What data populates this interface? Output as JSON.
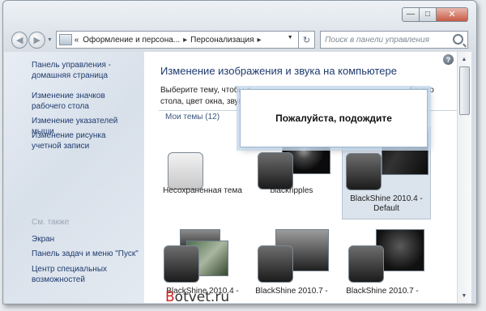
{
  "window": {
    "caption": {
      "min": "—",
      "max": "□",
      "close": "✕"
    }
  },
  "nav": {
    "back": "◀",
    "forward": "▶",
    "breadcrumb_start": "«",
    "crumbs": [
      "Оформление и персона...",
      "Персонализация"
    ],
    "search_placeholder": "Поиск в панели управления"
  },
  "sidebar": {
    "home": "Панель управления - домашняя страница",
    "items": [
      "Изменение значков рабочего стола",
      "Изменение указателей мыши",
      "Изменение рисунка учетной записи"
    ],
    "see_also_title": "См. также",
    "see_also": [
      "Экран",
      "Панель задач и меню \"Пуск\"",
      "Центр специальных возможностей"
    ]
  },
  "main": {
    "help": "?",
    "title": "Изменение изображения и звука на компьютере",
    "description_left": "Выберите тему, чтобы с",
    "description_right": "бочего",
    "description_line2_left": "стола, цвет окна, звуки",
    "themes_header": "Мои темы (12)",
    "themes": [
      {
        "name": "Несохраненная тема"
      },
      {
        "name": "blackripples"
      },
      {
        "name": "BlackShine 2010.4 - Default"
      },
      {
        "name": "BlackShine 2010.4 -"
      },
      {
        "name": "BlackShine 2010.7 -"
      },
      {
        "name": "BlackShine 2010.7 -"
      }
    ]
  },
  "dialog": {
    "message": "Пожалуйста, подождите"
  },
  "watermark": {
    "prefix": "B",
    "rest": "otvet.ru"
  }
}
